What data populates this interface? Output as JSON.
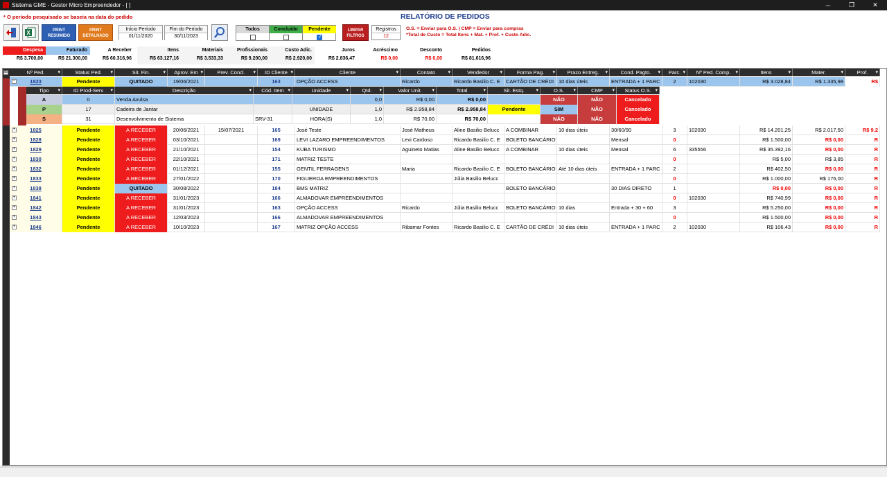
{
  "window": {
    "title": "Sistema GME - Gestor Micro Empreendedor - [ ]"
  },
  "header": {
    "note": "* O período pesquisado se baseia na data do pedido",
    "title": "RELATÓRIO DE PEDIDOS",
    "print_summary": "PRINT RESUMIDO",
    "print_detailed": "PRINT DETALHADO",
    "start_label": "Início Período",
    "start_value": "01/11/2020",
    "end_label": "Fim do Período",
    "end_value": "30/11/2023",
    "filters": {
      "todos": "Todos",
      "concluido": "Concluído",
      "pendente": "Pendente"
    },
    "clear_filters": "LIMPAR FILTROS",
    "records_label": "Registros",
    "records_value": "12",
    "legend_line1": "O.S. = Enviar para O.S. | CMP = Enviar para compras",
    "legend_line2": "*Total de Custo = Total Itens + Mat. + Prof. + Custo Adic."
  },
  "totals": [
    {
      "label": "Despesa",
      "value": "R$ 3.700,00"
    },
    {
      "label": "Faturado",
      "value": "R$ 21.300,00"
    },
    {
      "label": "A Receber",
      "value": "R$ 60.316,96"
    },
    {
      "label": "Itens",
      "value": "R$ 63.127,16"
    },
    {
      "label": "Materiais",
      "value": "R$ 3.533,33"
    },
    {
      "label": "Profissionais",
      "value": "R$ 9.200,00"
    },
    {
      "label": "Custo Adic.",
      "value": "R$ 2.920,00"
    },
    {
      "label": "Juros",
      "value": "R$ 2.836,47"
    },
    {
      "label": "Acréscimo",
      "value": "R$ 0,00"
    },
    {
      "label": "Desconto",
      "value": "R$ 0,00"
    },
    {
      "label": "Pedidos",
      "value": "R$ 81.616,96"
    }
  ],
  "grid": {
    "columns": [
      "Nº Ped.",
      "Status Ped.",
      "Sit. Fin.",
      "Aprov. Em",
      "Prev. Concl.",
      "ID Cliente",
      "Cliente",
      "Contato",
      "Vendedor",
      "Forma Pag.",
      "Prazo Entreg.",
      "Cond. Pagto.",
      "Parc.",
      "Nº Ped. Comp.",
      "Itens",
      "Mater.",
      "Prof."
    ],
    "expanded_row": {
      "num": "1823",
      "status": "Pendente",
      "fin": "QUITADO",
      "aprov": "19/06/2021",
      "prev": "",
      "idc": "163",
      "cliente": "OPÇÃO ACCESS",
      "contato": "Ricardo",
      "vendedor": "Ricardo Basilio C. E",
      "forma": "CARTÃO DE CRÉDI",
      "prazo": "10 dias úteis",
      "cond": "ENTRADA + 1 PARC",
      "parc": "2",
      "pcomp": "102030",
      "itens": "R$ 3.028,84",
      "mater": "R$ 1.335,98",
      "prof": "R$"
    },
    "sub_columns": [
      "Tipo",
      "ID Prod-Serv",
      "Descrição",
      "Cód. Item",
      "Unidade",
      "Qtd.",
      "Valor Unit.",
      "Total",
      "Sit. Estq.",
      "O.S.",
      "CMP",
      "Status O.S."
    ],
    "sub_rows": [
      {
        "tipo": "A",
        "id": "0",
        "desc": "Venda Avulsa",
        "cod": "",
        "un": "",
        "qtd": "0,0",
        "vu": "R$ 0,00",
        "total": "R$ 0,00",
        "estq": "",
        "os": "NÃO",
        "cmp": "NÃO",
        "st": "Cancelado"
      },
      {
        "tipo": "P",
        "id": "17",
        "desc": "Cadeira de Jantar",
        "cod": "",
        "un": "UNIDADE",
        "qtd": "1,0",
        "vu": "R$ 2.958,84",
        "total": "R$ 2.958,84",
        "estq": "Pendente",
        "os": "SIM",
        "cmp": "NÃO",
        "st": "Cancelado"
      },
      {
        "tipo": "S",
        "id": "31",
        "desc": "Desenvolvimento de Sistema",
        "cod": "SRV-31",
        "un": "HORA(S)",
        "qtd": "1,0",
        "vu": "R$ 70,00",
        "total": "R$ 70,00",
        "estq": "",
        "os": "NÃO",
        "cmp": "NÃO",
        "st": "Cancelado"
      }
    ],
    "rows": [
      {
        "num": "1825",
        "status": "Pendente",
        "fin": "A RECEBER",
        "aprov": "20/06/2021",
        "prev": "15/07/2021",
        "idc": "165",
        "cliente": "José Teste",
        "contato": "José Matheus",
        "vendedor": "Aline Basilio Belucc",
        "forma": "A COMBINAR",
        "prazo": "10 dias úteis",
        "cond": "30/60/90",
        "parc": "3",
        "pcomp": "102030",
        "itens": "R$ 14.201,25",
        "mater": "R$ 2.017,50",
        "prof": "R$ 9.2"
      },
      {
        "num": "1828",
        "status": "Pendente",
        "fin": "A RECEBER",
        "aprov": "03/10/2021",
        "prev": "",
        "idc": "169",
        "cliente": "LEVI LAZARO EMPREENDIMENTOS",
        "contato": "Levi Cardoso",
        "vendedor": "Ricardo Basilio C. E",
        "forma": "BOLETO BANCÁRIO",
        "prazo": "",
        "cond": "Mensal",
        "parc": "0",
        "pcomp": "",
        "itens": "R$ 1.500,00",
        "mater": "R$ 0,00",
        "prof": "R"
      },
      {
        "num": "1829",
        "status": "Pendente",
        "fin": "A RECEBER",
        "aprov": "21/10/2021",
        "prev": "",
        "idc": "154",
        "cliente": "KUBA TURISMO",
        "contato": "Aguineto Matias",
        "vendedor": "Aline Basilio Belucc",
        "forma": "A COMBINAR",
        "prazo": "10 dias úteis",
        "cond": "Mensal",
        "parc": "6",
        "pcomp": "335556",
        "itens": "R$ 35.392,16",
        "mater": "R$ 0,00",
        "prof": "R"
      },
      {
        "num": "1830",
        "status": "Pendente",
        "fin": "A RECEBER",
        "aprov": "22/10/2021",
        "prev": "",
        "idc": "171",
        "cliente": "MATRIZ TESTE",
        "contato": "",
        "vendedor": "",
        "forma": "",
        "prazo": "",
        "cond": "",
        "parc": "0",
        "pcomp": "",
        "itens": "R$ 5,00",
        "mater": "R$ 3,85",
        "prof": "R"
      },
      {
        "num": "1832",
        "status": "Pendente",
        "fin": "A RECEBER",
        "aprov": "01/12/2021",
        "prev": "",
        "idc": "155",
        "cliente": "GENTIL FERRAGENS",
        "contato": "Maria",
        "vendedor": "Ricardo Basilio C. E",
        "forma": "BOLETO BANCÁRIO",
        "prazo": "Até 10 dias úteis",
        "cond": "ENTRADA + 1 PARC",
        "parc": "2",
        "pcomp": "",
        "itens": "R$ 402,50",
        "mater": "R$ 0,00",
        "prof": "R"
      },
      {
        "num": "1833",
        "status": "Pendente",
        "fin": "A RECEBER",
        "aprov": "27/01/2022",
        "prev": "",
        "idc": "170",
        "cliente": "FIGUEROA EMPREENDIMENTOS",
        "contato": "",
        "vendedor": "Júlia Basilio Belucc",
        "forma": "",
        "prazo": "",
        "cond": "",
        "parc": "0",
        "pcomp": "",
        "itens": "R$ 1.000,00",
        "mater": "R$ 176,00",
        "prof": "R"
      },
      {
        "num": "1838",
        "status": "Pendente",
        "fin": "QUITADO",
        "aprov": "30/08/2022",
        "prev": "",
        "idc": "184",
        "cliente": "BMS MATRIZ",
        "contato": "",
        "vendedor": "",
        "forma": "BOLETO BANCÁRIO",
        "prazo": "",
        "cond": "30 DIAS DIRETO",
        "parc": "1",
        "pcomp": "",
        "itens": "R$ 0,00",
        "mater": "R$ 0,00",
        "prof": "R"
      },
      {
        "num": "1841",
        "status": "Pendente",
        "fin": "A RECEBER",
        "aprov": "31/01/2023",
        "prev": "",
        "idc": "166",
        "cliente": "ALMADOVAR EMPREENDIMENTOS",
        "contato": "",
        "vendedor": "",
        "forma": "",
        "prazo": "",
        "cond": "",
        "parc": "0",
        "pcomp": "102030",
        "itens": "R$ 740,99",
        "mater": "R$ 0,00",
        "prof": "R"
      },
      {
        "num": "1842",
        "status": "Pendente",
        "fin": "A RECEBER",
        "aprov": "31/01/2023",
        "prev": "",
        "idc": "163",
        "cliente": "OPÇÃO ACCESS",
        "contato": "Ricardo",
        "vendedor": "Júlia Basilio Belucc",
        "forma": "BOLETO BANCÁRIO",
        "prazo": "10 dias",
        "cond": "Entrada  + 30 + 60",
        "parc": "3",
        "pcomp": "",
        "itens": "R$ 5.250,00",
        "mater": "R$ 0,00",
        "prof": "R"
      },
      {
        "num": "1843",
        "status": "Pendente",
        "fin": "A RECEBER",
        "aprov": "12/03/2023",
        "prev": "",
        "idc": "166",
        "cliente": "ALMADOVAR EMPREENDIMENTOS",
        "contato": "",
        "vendedor": "",
        "forma": "",
        "prazo": "",
        "cond": "",
        "parc": "0",
        "pcomp": "",
        "itens": "R$ 1.500,00",
        "mater": "R$ 0,00",
        "prof": "R"
      },
      {
        "num": "1846",
        "status": "Pendente",
        "fin": "A RECEBER",
        "aprov": "10/10/2023",
        "prev": "",
        "idc": "167",
        "cliente": "MATRIZ OPÇÃO ACCESS",
        "contato": "Ribamar Fontes",
        "vendedor": "Ricardo Basilio C. E",
        "forma": "CARTÃO DE CRÉDI",
        "prazo": "10 dias úteis",
        "cond": "ENTRADA + 1 PARC",
        "parc": "2",
        "pcomp": "102030",
        "itens": "R$ 106,43",
        "mater": "R$ 0,00",
        "prof": "R"
      }
    ]
  }
}
